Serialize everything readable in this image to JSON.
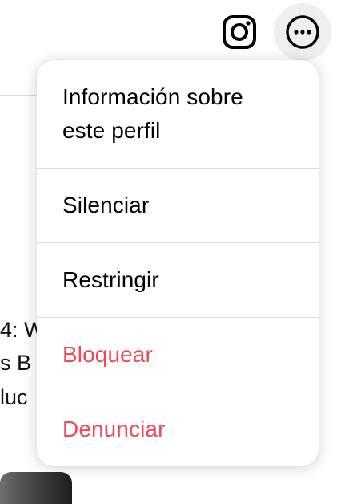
{
  "header": {
    "instagram_icon": "instagram-icon",
    "more_icon": "more-horizontal-icon"
  },
  "background": {
    "text_lines": [
      "4: W",
      "s B",
      "luc"
    ]
  },
  "menu": {
    "items": [
      {
        "label": "Información sobre este perfil",
        "style": "normal"
      },
      {
        "label": "Silenciar",
        "style": "normal"
      },
      {
        "label": "Restringir",
        "style": "normal"
      },
      {
        "label": "Bloquear",
        "style": "danger"
      },
      {
        "label": "Denunciar",
        "style": "danger"
      }
    ]
  },
  "colors": {
    "danger": "#ed4956",
    "separator": "#dbdbdb",
    "more_button_bg": "#efefef"
  }
}
